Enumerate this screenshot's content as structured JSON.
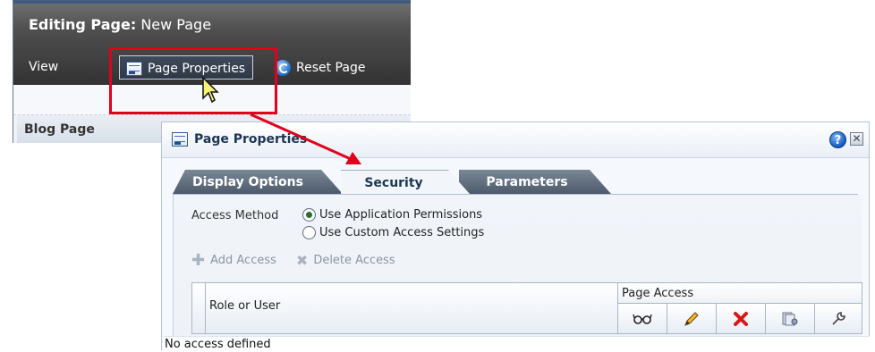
{
  "editor": {
    "title_prefix": "Editing Page:",
    "title_name": "New Page",
    "toolbar": {
      "view_label": "View",
      "properties_label": "Page Properties",
      "reset_label": "Reset Page"
    },
    "section_title": "Blog Page"
  },
  "dialog": {
    "title": "Page Properties",
    "help_label": "?",
    "close_label": "✕",
    "tabs": [
      {
        "label": "Display Options",
        "selected": false
      },
      {
        "label": "Security",
        "selected": true
      },
      {
        "label": "Parameters",
        "selected": false
      }
    ],
    "access_method": {
      "label": "Access Method",
      "options": [
        {
          "label": "Use Application Permissions",
          "selected": true
        },
        {
          "label": "Use Custom Access Settings",
          "selected": false
        }
      ]
    },
    "actions": {
      "add_label": "Add Access",
      "delete_label": "Delete Access"
    },
    "table": {
      "role_header": "Role or User",
      "access_header": "Page Access",
      "permission_icons": [
        "view-icon",
        "edit-icon",
        "delete-icon",
        "manage-icon",
        "customize-icon"
      ],
      "empty_text": "No access defined"
    }
  },
  "colors": {
    "highlight": "#e3001b",
    "toolbar_dark": "#333333",
    "tab_inactive": "#5b6878",
    "dialog_bg": "#f5f8fc"
  }
}
